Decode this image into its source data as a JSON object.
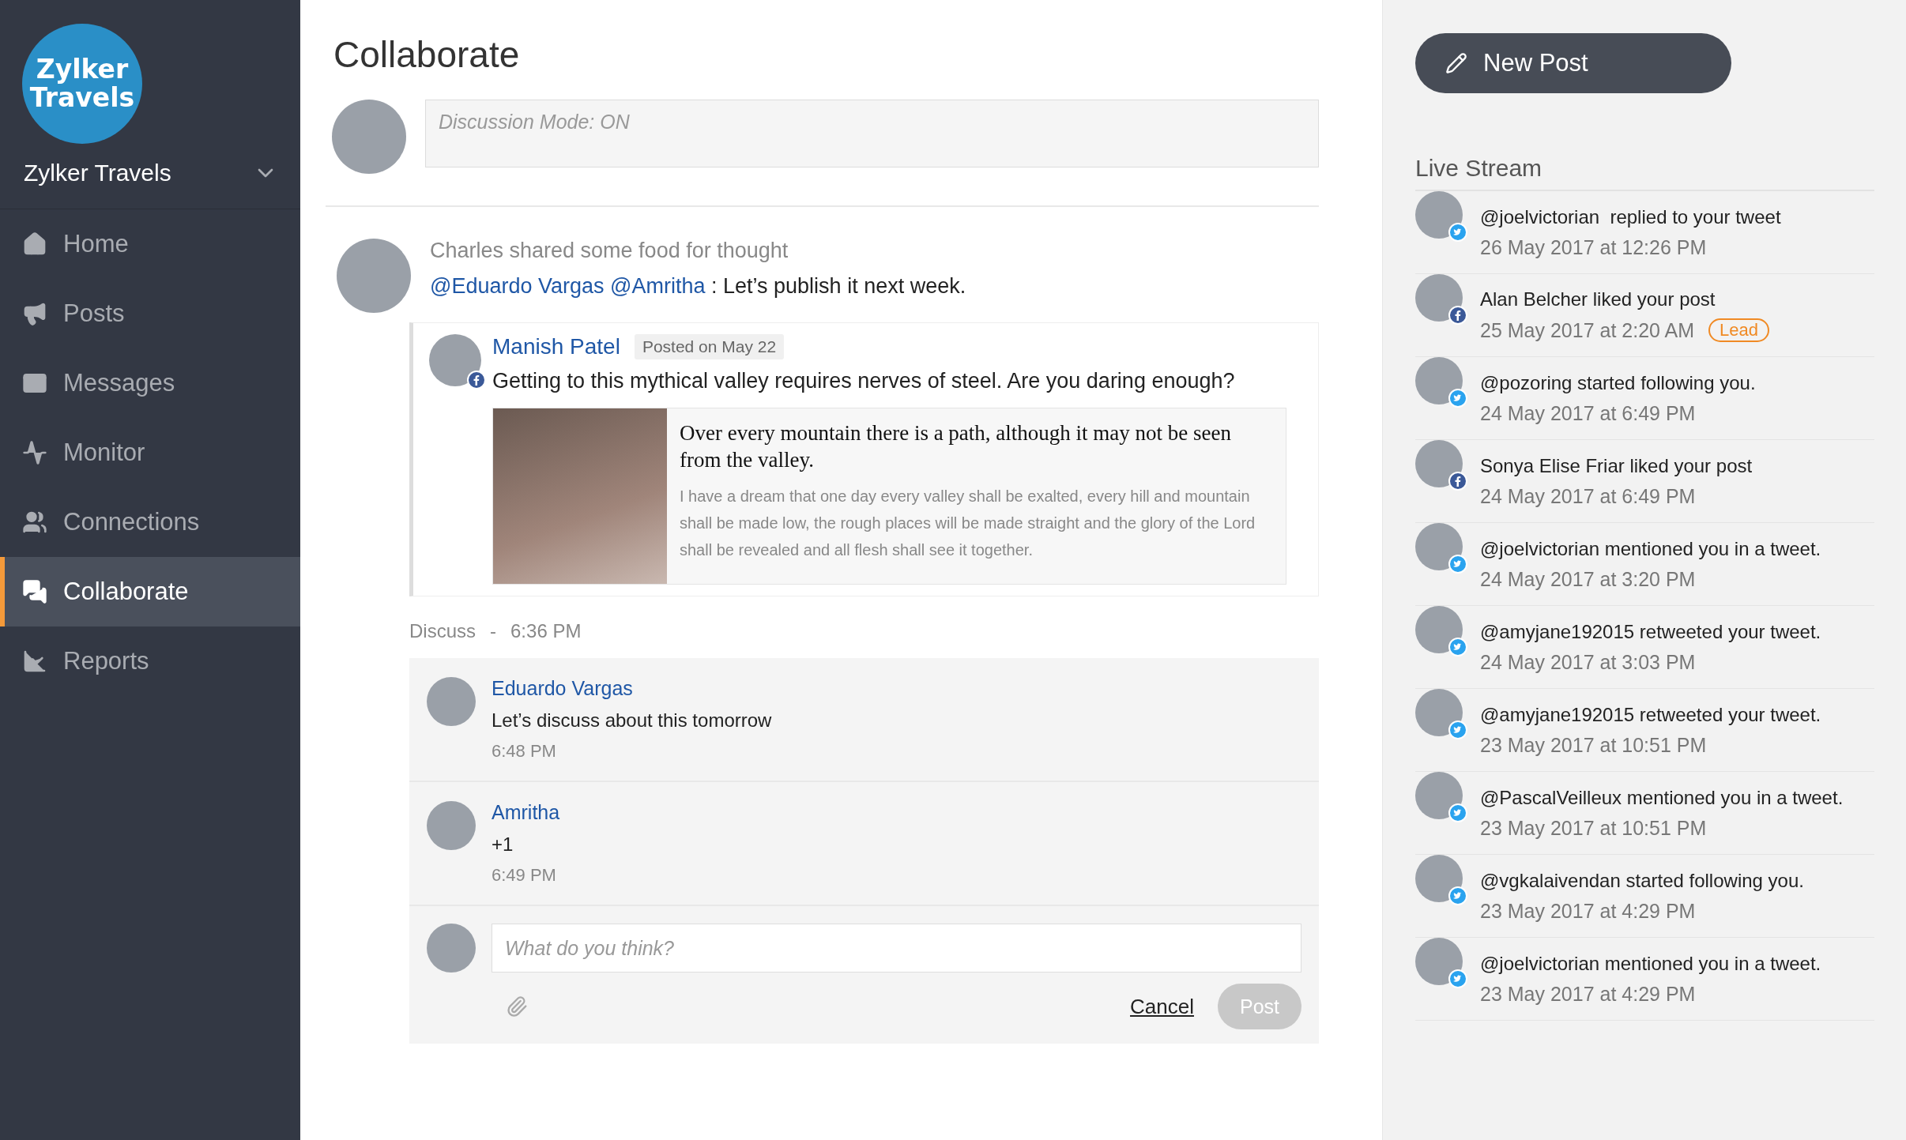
{
  "sidebar": {
    "logo": {
      "line_1": "Zylker",
      "line_2": "Travels"
    },
    "brand": "Zylker Travels",
    "items": [
      {
        "label": "Home",
        "selected": false
      },
      {
        "label": "Posts",
        "selected": false
      },
      {
        "label": "Messages",
        "selected": false
      },
      {
        "label": "Monitor",
        "selected": false
      },
      {
        "label": "Connections",
        "selected": false
      },
      {
        "label": "Collaborate",
        "selected": true
      },
      {
        "label": "Reports",
        "selected": false
      }
    ]
  },
  "main": {
    "title": "Collaborate",
    "composer": {
      "placeholder": "Discussion Mode: ON"
    },
    "post": {
      "headline": "Charles shared some food for thought",
      "mentions": [
        "@Eduardo Vargas",
        "@Amritha"
      ],
      "message": ": Let’s publish it next week.",
      "shared": {
        "author": "Manish Patel",
        "kind": "facebook",
        "posted": "Posted on May 22",
        "text": "Getting to this mythical valley requires nerves of steel. Are you daring enough?",
        "link_card": {
          "title": "Over every mountain there is a path, although it may not be seen from the valley.",
          "body": "I have a dream that one day every valley shall be exalted, every hill and mountain shall be made low, the rough places will be made straight and the glory of the Lord shall be revealed and all flesh shall see it together."
        }
      },
      "discuss": {
        "label": "Discuss",
        "separator": "-",
        "time": "6:36 PM"
      },
      "comments": [
        {
          "author": "Eduardo Vargas",
          "text": "Let’s discuss about this tomorrow",
          "time": "6:48 PM"
        },
        {
          "author": "Amritha",
          "text": "+1",
          "time": "6:49 PM"
        }
      ],
      "reply": {
        "placeholder": "What do you think?",
        "cancel": "Cancel",
        "post": "Post",
        "disabled": true
      }
    }
  },
  "right_panel": {
    "new_post": "New Post",
    "title": "Live Stream",
    "items": [
      {
        "text": "@joelvictorian  replied to your tweet",
        "date": "26 May 2017 at 12:26 PM",
        "kind": "twitter"
      },
      {
        "text": "Alan Belcher liked your post",
        "date": "25 May 2017 at 2:20 AM",
        "kind": "facebook",
        "tag": "Lead"
      },
      {
        "text": "@pozoring started following you.",
        "date": "24 May 2017 at 6:49 PM",
        "kind": "twitter"
      },
      {
        "text": "Sonya Elise Friar liked your post",
        "date": "24 May 2017 at 6:49 PM",
        "kind": "facebook"
      },
      {
        "text": "@joelvictorian mentioned you in a tweet.",
        "date": "24 May 2017 at 3:20 PM",
        "kind": "twitter"
      },
      {
        "text": "@amyjane192015 retweeted your tweet.",
        "date": "24 May 2017 at 3:03 PM",
        "kind": "twitter"
      },
      {
        "text": "@amyjane192015 retweeted your tweet.",
        "date": "23 May 2017 at 10:51 PM",
        "kind": "twitter"
      },
      {
        "text": "@PascalVeilleux mentioned you in a tweet.",
        "date": "23 May 2017 at 10:51 PM",
        "kind": "twitter"
      },
      {
        "text": "@vgkalaivendan started following you.",
        "date": "23 May 2017 at 4:29 PM",
        "kind": "twitter"
      },
      {
        "text": "@joelvictorian mentioned you in a tweet.",
        "date": "23 May 2017 at 4:29 PM",
        "kind": "twitter"
      }
    ]
  }
}
